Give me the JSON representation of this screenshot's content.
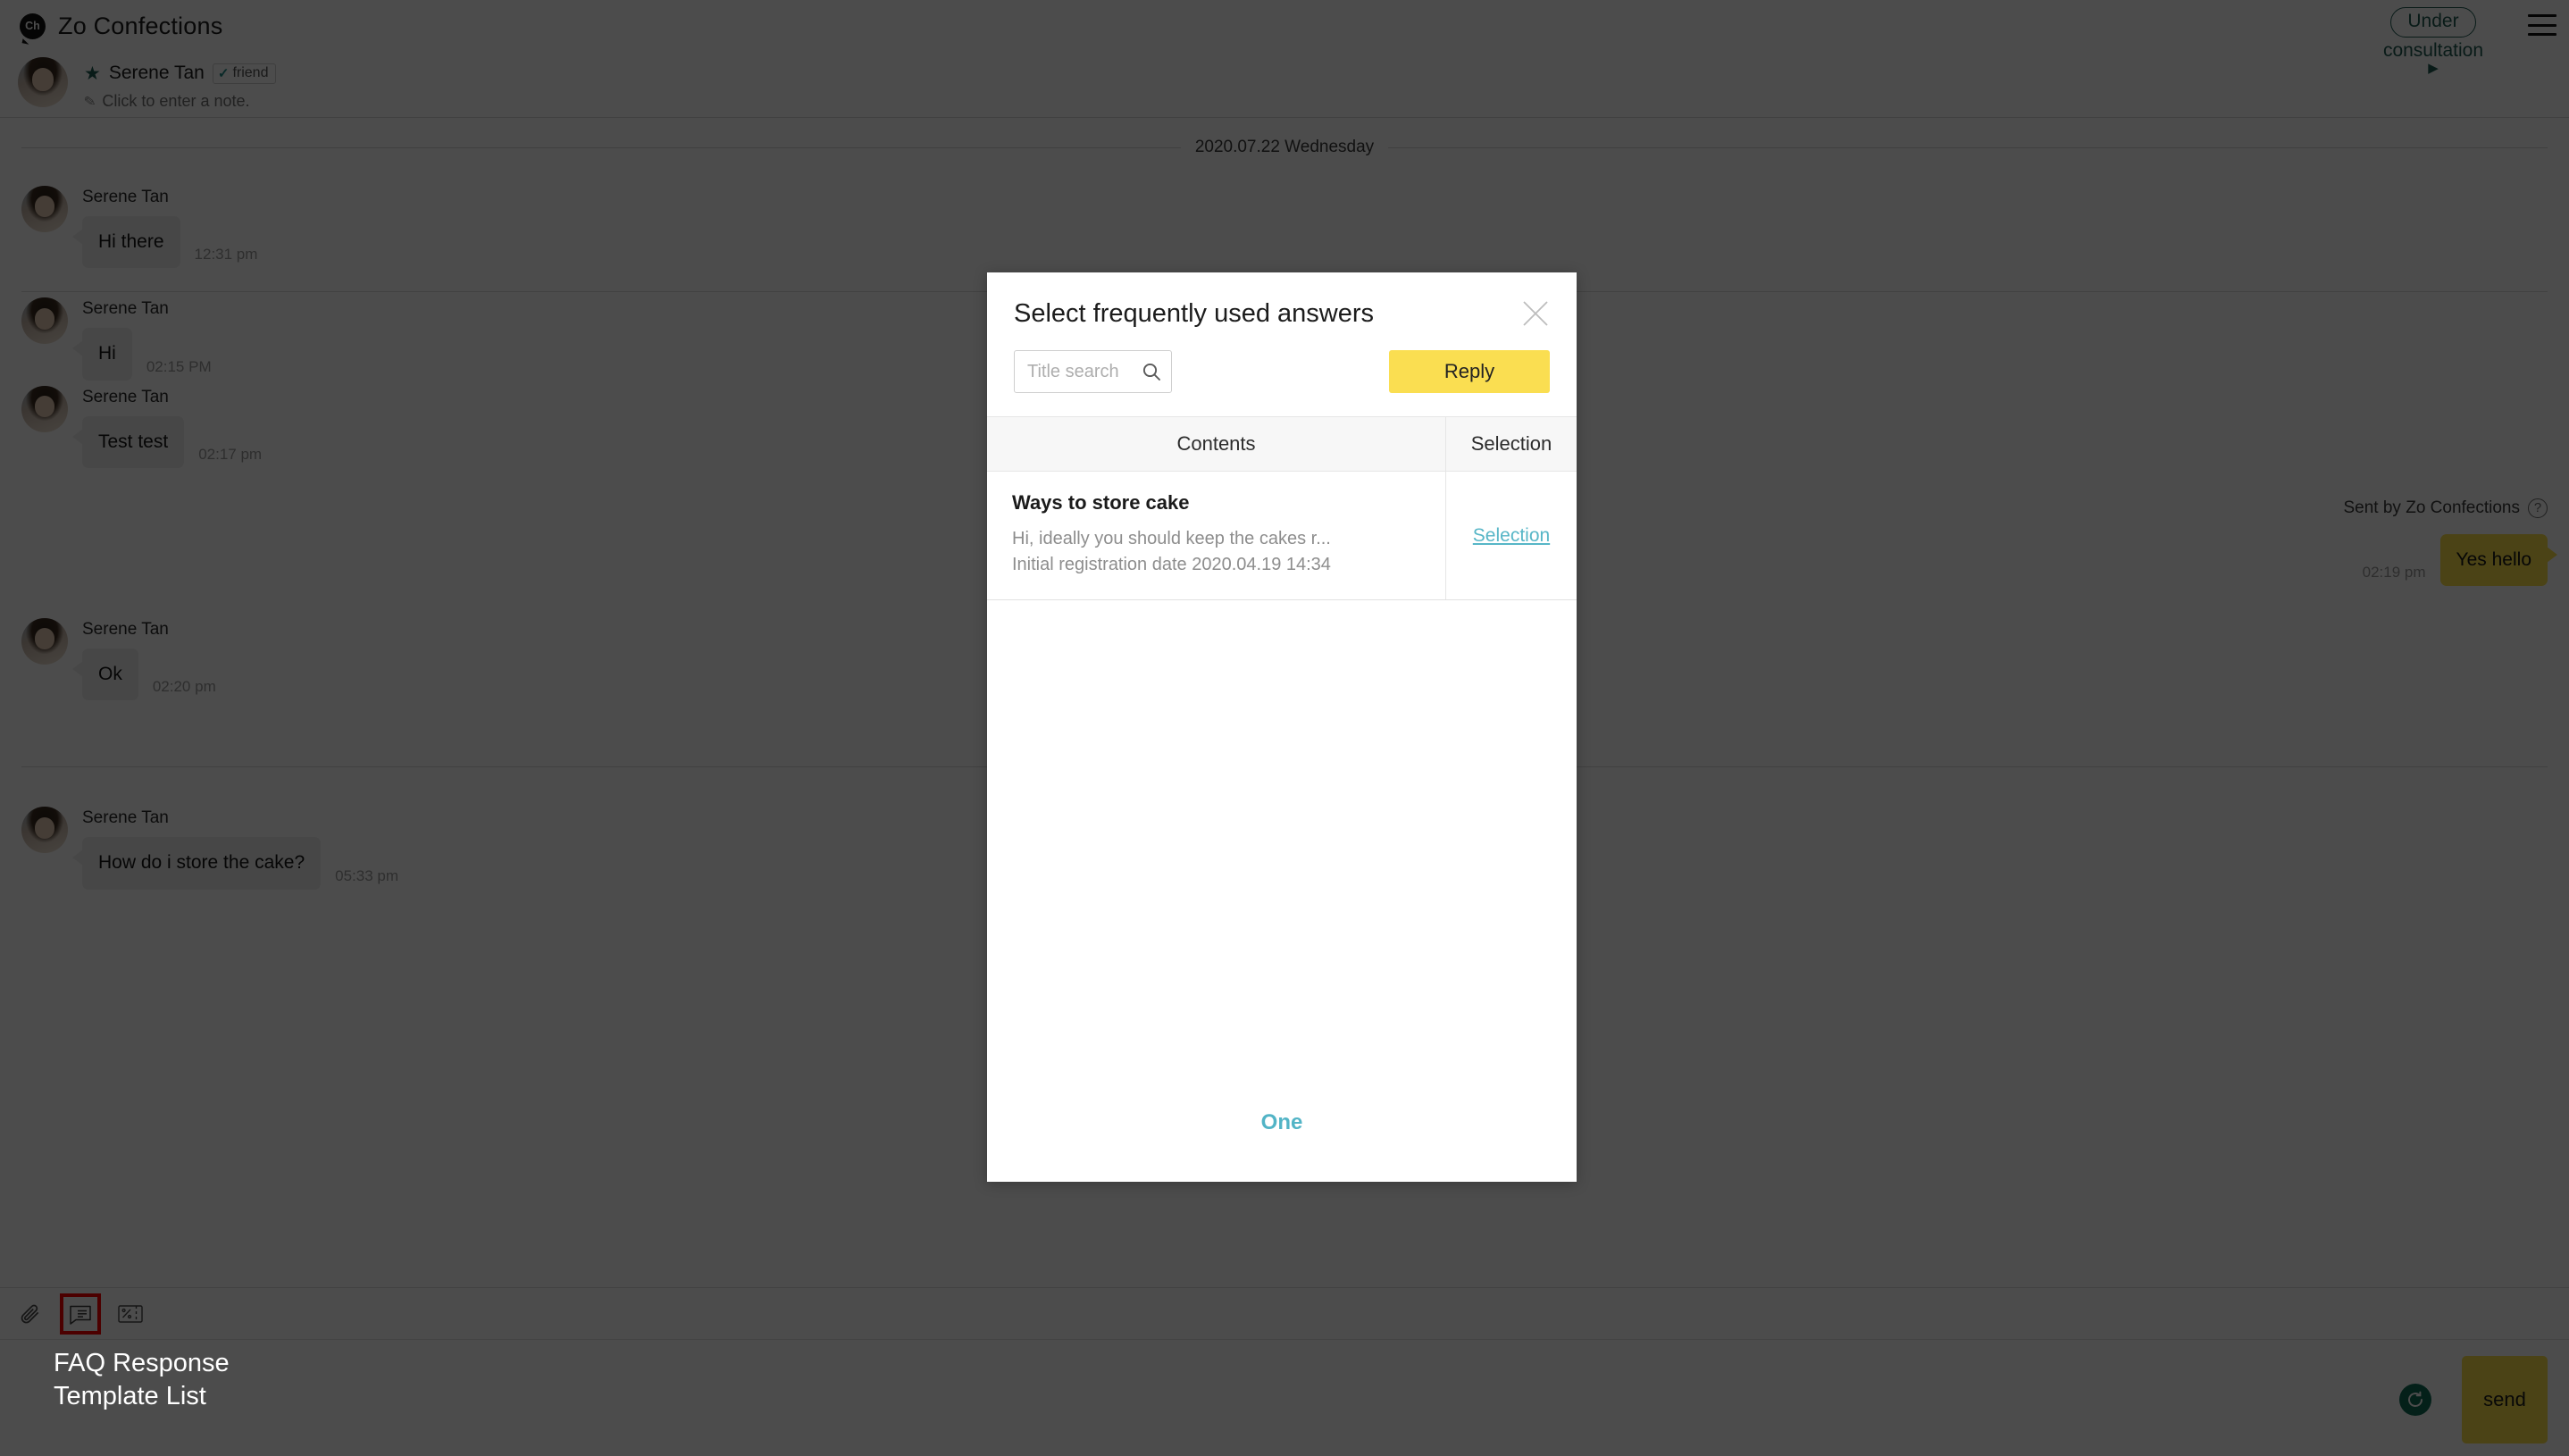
{
  "app": {
    "brand": {
      "logo_text": "Ch",
      "name": "Zo Confections"
    },
    "status": {
      "badge_line1": "Under",
      "badge_line2": "consultation",
      "caret": "▶",
      "menu_icon": "hamburger-menu-icon"
    }
  },
  "contact": {
    "star_icon": "★",
    "name": "Serene Tan",
    "friend_badge": {
      "check": "✓",
      "label": "friend"
    },
    "note_icon": "✎",
    "note_placeholder": "Click to enter a note."
  },
  "conversation": {
    "date_divider": "2020.07.22 Wednesday",
    "sent_by_label": "Sent by Zo Confections",
    "help_icon": "?",
    "groups": [
      {
        "messages": [
          {
            "sender": "Serene Tan",
            "text": "Hi there",
            "time": "12:31 pm",
            "direction": "in"
          }
        ]
      },
      {
        "messages": [
          {
            "sender": "Serene Tan",
            "text": "Hi",
            "time": "02:15 PM",
            "direction": "in"
          },
          {
            "sender": "Serene Tan",
            "text": "Test test",
            "time": "02:17 pm",
            "direction": "in"
          },
          {
            "sender": "Zo Confections",
            "text": "Yes hello",
            "time": "02:19 pm",
            "direction": "out"
          },
          {
            "sender": "Serene Tan",
            "text": "Ok",
            "time": "02:20 pm",
            "direction": "in"
          }
        ]
      },
      {
        "messages": [
          {
            "sender": "Serene Tan",
            "text": "How do i store the cake?",
            "time": "05:33 pm",
            "direction": "in"
          }
        ]
      }
    ]
  },
  "composer": {
    "tools": [
      {
        "name": "attachment-icon",
        "title": "Attach file",
        "highlighted": false
      },
      {
        "name": "faq-template-icon",
        "title": "FAQ response template list",
        "highlighted": true
      },
      {
        "name": "coupon-icon",
        "title": "Coupon",
        "highlighted": false
      }
    ],
    "refresh_icon": "refresh-icon",
    "send_label": "send",
    "message_value": ""
  },
  "annotation": {
    "text": "FAQ Response Template List"
  },
  "modal": {
    "title": "Select frequently used answers",
    "close_icon": "close-icon",
    "search": {
      "placeholder": "Title search",
      "value": "",
      "icon": "search-icon"
    },
    "reply_label": "Reply",
    "table": {
      "headers": [
        "Contents",
        "Selection"
      ],
      "rows": [
        {
          "title": "Ways to store cake",
          "preview": "Hi, ideally you should keep the cakes r...",
          "registered": "Initial registration date 2020.04.19 14:34",
          "action": "Selection"
        }
      ]
    },
    "pagination": {
      "current": "One"
    }
  },
  "colors": {
    "accent_yellow": "#fae14b",
    "modal_yellow": "#fade51",
    "teal": "#1f5a53",
    "link_blue": "#57b6c7",
    "highlight_red": "#ff0000"
  }
}
